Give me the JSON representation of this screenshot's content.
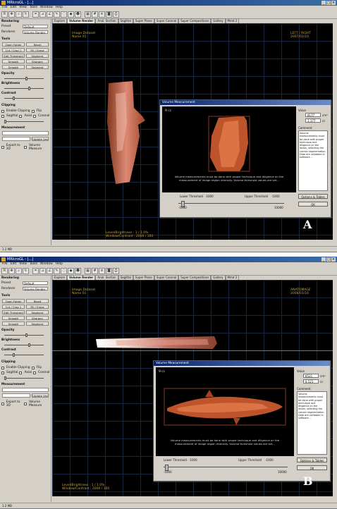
{
  "panel_a": {
    "title": "MRIcroGL - [...]",
    "menu": [
      "File",
      "Edit",
      "View",
      "Tools",
      "Window",
      "Help"
    ],
    "left": {
      "section1": "Rendering",
      "label1": "Preset",
      "value1": "Default",
      "label2": "Renderer",
      "value2": "Volume Render",
      "section2": "Tools",
      "btn_open": "Open Folder",
      "btn_reset": "Reset",
      "btn_l1": "Cut / Crop 1",
      "btn_l2": "Edit Threshold",
      "btn_r1": "Fill / Erase",
      "btn_r2": "Segment",
      "btn_s1": "Smooth",
      "btn_s2": "Sharpen",
      "section3": "Opacity",
      "section4": "Brightness",
      "section5": "Contrast",
      "section6": "Clipping",
      "chk1": "Enable Clipping",
      "chk2": "Flip",
      "chk3": "Sagittal",
      "chk4": "Axial",
      "chk5": "Coronal",
      "section7": "Measurement",
      "btn_update": "Update Ves",
      "chk6": "Export to 3D",
      "chk7": "Volume Measure"
    },
    "tabs": [
      "Explore",
      "Volume Render",
      "Anal. Section",
      "Sagittal",
      "Super Plane",
      "Super Coronal",
      "Super Compositions",
      "Gallery",
      "Mmd 2"
    ],
    "viewport": {
      "top_left_1": "Image Dataset",
      "top_left_2": "Name 01",
      "top_right_1": "LEFT / RIGHT",
      "top_right_2": "2007/01/10",
      "bottom_left_1": "Level/Brightness  :  1 / 1.0%",
      "bottom_left_2": "Window/Contrast  :  2000 / 100"
    },
    "dialog": {
      "title": "Volume Measurement",
      "label": "9 cc",
      "volume_label": "Value",
      "volume_value": "8177",
      "volume_unit": "cm³",
      "volume_value2": "3.177",
      "volume_unit2": "cc",
      "desc_title": "Comment",
      "desc": "Volume measurements must be done with proper technique and diligence on the lesion, selecting the correct segmentation. Data are validated in software...",
      "caption": "Volume measurements must be done with proper technique and diligence on the measurement of image region intensity. Volume threshold values are set...",
      "lower_label": "Lower Threshold",
      "lower_value": "-1000",
      "upper_label": "Upper Threshold",
      "upper_value": "-1000",
      "scale_min": "-1000",
      "scale_max": "10000",
      "btn_options": "Options & Tables",
      "btn_ok": "OK"
    },
    "status": "1.2 MB",
    "letter": "A"
  },
  "panel_b": {
    "title": "MRIcroGL - [...]",
    "menu": [
      "File",
      "Edit",
      "View",
      "Tools",
      "Window",
      "Help"
    ],
    "left": {
      "section1": "Rendering",
      "label1": "Preset",
      "value1": "Default",
      "label2": "Renderer",
      "value2": "Volume Render",
      "section2": "Tools",
      "btn_open": "Open Folder",
      "btn_reset": "Reset",
      "btn_l1": "Cut / Crop 1",
      "btn_l2": "Edit Threshold",
      "btn_r1": "Fill / Erase",
      "btn_r2": "Segment",
      "btn_s1": "Smooth",
      "btn_s2": "Sharpen",
      "section3": "Opacity",
      "section4": "Brightness",
      "section5": "Contrast",
      "section6": "Clipping",
      "chk1": "Enable Clipping",
      "chk2": "Flip",
      "chk3": "Sagittal",
      "chk4": "Axial",
      "chk5": "Coronal",
      "section7": "Measurement",
      "btn_update": "Update Ves",
      "chk6": "Export to 3D",
      "chk7": "Volume Measure"
    },
    "tabs": [
      "Explore",
      "Volume Render",
      "Anal. Section",
      "Sagittal",
      "Super Plane",
      "Super Coronal",
      "Super Compositions",
      "Gallery",
      "Mmd 2"
    ],
    "viewport": {
      "top_left_1": "Image Dataset",
      "top_left_2": "Name 01",
      "top_right_1": "ANATOMAGE",
      "top_right_2": "2008/01/16",
      "bottom_left_1": "Level/Brightness  :  1 / 1.0%",
      "bottom_left_2": "Window/Contrast  :  2000 / 100"
    },
    "dialog": {
      "title": "Volume Measurement",
      "label": "9 cc",
      "volume_label": "Value",
      "volume_value": "8521",
      "volume_unit": "cm³",
      "volume_value2": "8.521",
      "volume_unit2": "cc",
      "desc_title": "Comment",
      "desc": "Volume measurements must be done with proper technique and diligence on the lesion, selecting the correct segmentation. Data are validated in software...",
      "caption": "Volume measurements must be done with proper technique and diligence on the measurement of image region intensity. Volume threshold values are set...",
      "lower_label": "Lower Threshold",
      "lower_value": "-1000",
      "upper_label": "Upper Threshold",
      "upper_value": "-1000",
      "scale_min": "-1000",
      "scale_max": "10000",
      "btn_options": "Options & Tables",
      "btn_ok": "OK"
    },
    "status": "1.2 MB",
    "letter": "B"
  },
  "colors": {
    "viewport_bg": "#000000",
    "grid": "#1a2a48",
    "overlay_text": "#c8a040",
    "tissue": "#d2643c",
    "titlebar": "#0a246a"
  }
}
